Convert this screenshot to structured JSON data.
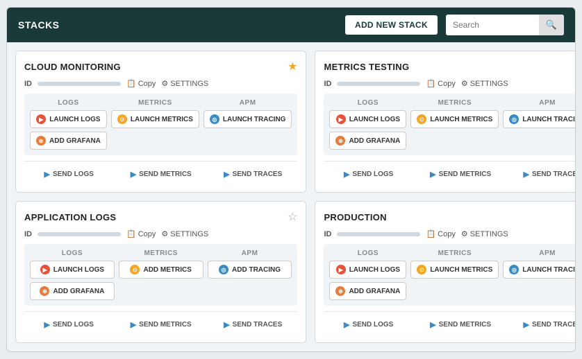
{
  "header": {
    "title": "STACKS",
    "add_button": "ADD NEW STACK",
    "search_placeholder": "Search"
  },
  "stacks": [
    {
      "id": "stack-cloud-monitoring",
      "name": "CLOUD MONITORING",
      "starred": true,
      "id_label": "ID",
      "copy_label": "Copy",
      "settings_label": "SETTINGS",
      "services": {
        "logs": {
          "title": "LOGS",
          "primary_label": "LAUNCH LOGS",
          "primary_type": "launch-logs"
        },
        "metrics": {
          "title": "METRICS",
          "primary_label": "LAUNCH METRICS",
          "primary_type": "launch-metrics"
        },
        "apm": {
          "title": "APM",
          "primary_label": "LAUNCH TRACING",
          "primary_type": "launch-apm"
        }
      },
      "extra_btn": "ADD GRAFANA",
      "send": [
        "SEND LOGS",
        "SEND METRICS",
        "SEND TRACES"
      ]
    },
    {
      "id": "stack-metrics-testing",
      "name": "METRICS TESTING",
      "starred": false,
      "id_label": "ID",
      "copy_label": "Copy",
      "settings_label": "SETTINGS",
      "services": {
        "logs": {
          "title": "LOGS",
          "primary_label": "LAUNCH LOGS",
          "primary_type": "launch-logs"
        },
        "metrics": {
          "title": "METRICS",
          "primary_label": "LAUNCH METRICS",
          "primary_type": "launch-metrics"
        },
        "apm": {
          "title": "APM",
          "primary_label": "LAUNCH TRACING",
          "primary_type": "launch-apm"
        }
      },
      "extra_btn": "ADD GRAFANA",
      "send": [
        "SEND LOGS",
        "SEND METRICS",
        "SEND TRACES"
      ]
    },
    {
      "id": "stack-application-logs",
      "name": "APPLICATION LOGS",
      "starred": false,
      "id_label": "ID",
      "copy_label": "Copy",
      "settings_label": "SETTINGS",
      "services": {
        "logs": {
          "title": "LOGS",
          "primary_label": "LAUNCH LOGS",
          "primary_type": "launch-logs"
        },
        "metrics": {
          "title": "METRICS",
          "primary_label": "ADD METRICS",
          "primary_type": "add-metrics"
        },
        "apm": {
          "title": "APM",
          "primary_label": "ADD TRACING",
          "primary_type": "add-apm"
        }
      },
      "extra_btn": "ADD GRAFANA",
      "send": [
        "SEND LOGS",
        "SEND METRICS",
        "SEND TRACES"
      ]
    },
    {
      "id": "stack-production",
      "name": "PRODUCTION",
      "starred": false,
      "id_label": "ID",
      "copy_label": "Copy",
      "settings_label": "SETTINGS",
      "services": {
        "logs": {
          "title": "LOGS",
          "primary_label": "LAUNCH LOGS",
          "primary_type": "launch-logs"
        },
        "metrics": {
          "title": "METRICS",
          "primary_label": "LAUNCH METRICS",
          "primary_type": "launch-metrics"
        },
        "apm": {
          "title": "APM",
          "primary_label": "LAUNCH TRACING",
          "primary_type": "launch-apm"
        }
      },
      "extra_btn": "ADD GRAFANA",
      "send": [
        "SEND LOGS",
        "SEND METRICS",
        "SEND TRACES"
      ]
    }
  ]
}
